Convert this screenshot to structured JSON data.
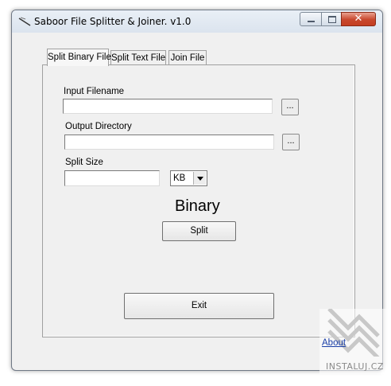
{
  "window": {
    "title": "Saboor File Splitter & Joiner. v1.0",
    "close_glyph": "✕"
  },
  "tabs": [
    {
      "label": "Split Binary File",
      "active": true
    },
    {
      "label": "Split Text File",
      "active": false
    },
    {
      "label": "Join File",
      "active": false
    }
  ],
  "form": {
    "input_filename_label": "Input Filename",
    "input_filename_value": "",
    "input_browse_label": "...",
    "output_directory_label": "Output Directory",
    "output_directory_value": "",
    "output_browse_label": "...",
    "split_size_label": "Split Size",
    "split_size_value": "",
    "unit_selected": "KB",
    "mode_label": "Binary",
    "split_button_label": "Split",
    "exit_button_label": "Exit"
  },
  "about_link": "About",
  "watermark": {
    "text": "INSTALUJ.CZ"
  },
  "icons": {
    "app": "feather-icon",
    "dropdown": "chevron-down-icon",
    "minimize": "minimize-icon",
    "maximize": "maximize-icon",
    "close": "close-icon"
  },
  "colors": {
    "window_bg": "#f0f0f0",
    "close_button": "#c8472c",
    "link": "#1a3fa8"
  }
}
